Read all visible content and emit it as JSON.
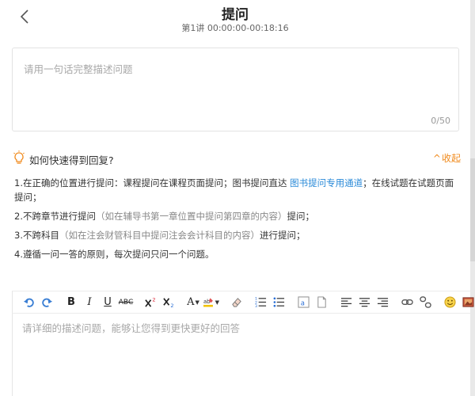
{
  "window": {
    "close_glyph": "×"
  },
  "header": {
    "back_icon": "chevron-left-icon",
    "title": "提问",
    "subtitle": "第1讲 00:00:00-00:18:16"
  },
  "question": {
    "placeholder": "请用一句话完整描述问题",
    "value": "",
    "counter": "0/50"
  },
  "tips": {
    "icon": "lightbulb-icon",
    "title": "如何快速得到回复?",
    "collapse_label": "收起",
    "collapse_caret": "^",
    "items": [
      {
        "text_a": "1.在正确的位置进行提问：课程提问在课程页面提问；图书提问直达 ",
        "link": "图书提问专用通道",
        "text_b": "；在线试题在试题页面提问；"
      },
      {
        "text_a": "2.不跨章节进行提问",
        "muted": "（如在辅导书第一章位置中提问第四章的内容）",
        "text_b": "提问；"
      },
      {
        "text_a": "3.不跨科目",
        "muted": "（如在注会财管科目中提问注会会计科目的内容）",
        "text_b": "进行提问；"
      },
      {
        "text_a": "4.遵循一问一答的原则，每次提问只问一个问题。"
      }
    ]
  },
  "toolbar": {
    "bold": "B",
    "italic": "I",
    "underline": "U",
    "strike": "ABC",
    "font_color": "A"
  },
  "editor": {
    "placeholder": "请详细的描述问题，能够让您得到更快更好的回答"
  },
  "colors": {
    "accent_orange": "#f08a1c",
    "link_blue": "#2a8ad8",
    "undo_blue": "#3b7fd4"
  }
}
